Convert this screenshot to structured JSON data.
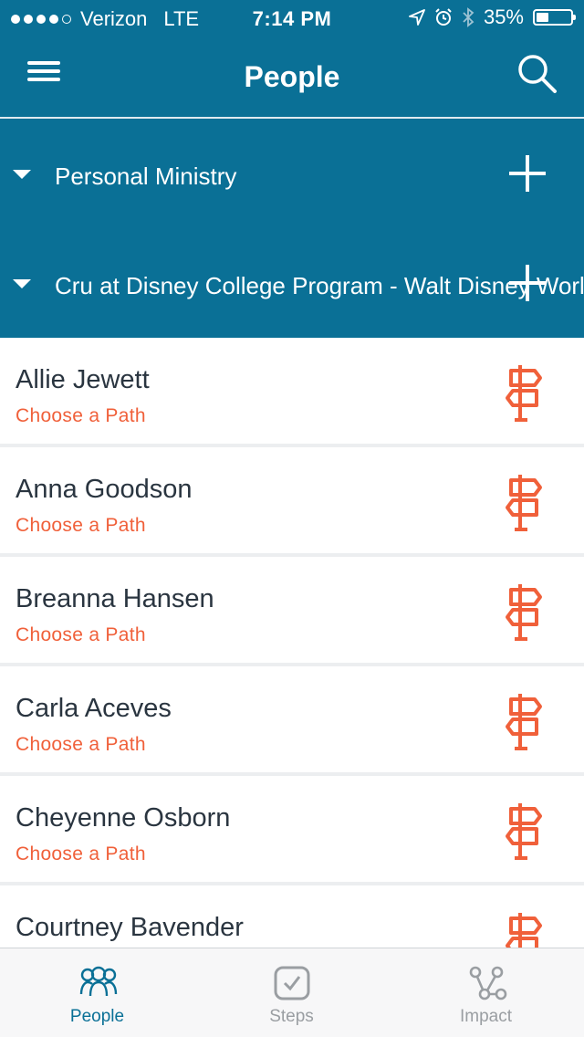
{
  "status_bar": {
    "carrier": "Verizon",
    "network": "LTE",
    "time": "7:14 PM",
    "battery": "35%",
    "battery_level": 0.35
  },
  "nav": {
    "title": "People",
    "menu_icon": "hamburger-menu-icon",
    "search_icon": "search-icon"
  },
  "groups": [
    {
      "label": "Personal Ministry"
    },
    {
      "label": "Cru at Disney College Program - Walt Disney World"
    }
  ],
  "people": [
    {
      "name": "Allie Jewett",
      "action": "Choose a Path"
    },
    {
      "name": "Anna Goodson",
      "action": "Choose a Path"
    },
    {
      "name": "Breanna Hansen",
      "action": "Choose a Path"
    },
    {
      "name": "Carla Aceves",
      "action": "Choose a Path"
    },
    {
      "name": "Cheyenne Osborn",
      "action": "Choose a Path"
    },
    {
      "name": "Courtney Bavender",
      "action": ""
    }
  ],
  "tabs": [
    {
      "label": "People",
      "icon": "people-icon",
      "active": true
    },
    {
      "label": "Steps",
      "icon": "steps-check-icon",
      "active": false
    },
    {
      "label": "Impact",
      "icon": "impact-network-icon",
      "active": false
    }
  ],
  "colors": {
    "header": "#0a7096",
    "accent": "#f0603a",
    "active_tab": "#0a7096",
    "inactive_tab": "#9a9ea2"
  }
}
